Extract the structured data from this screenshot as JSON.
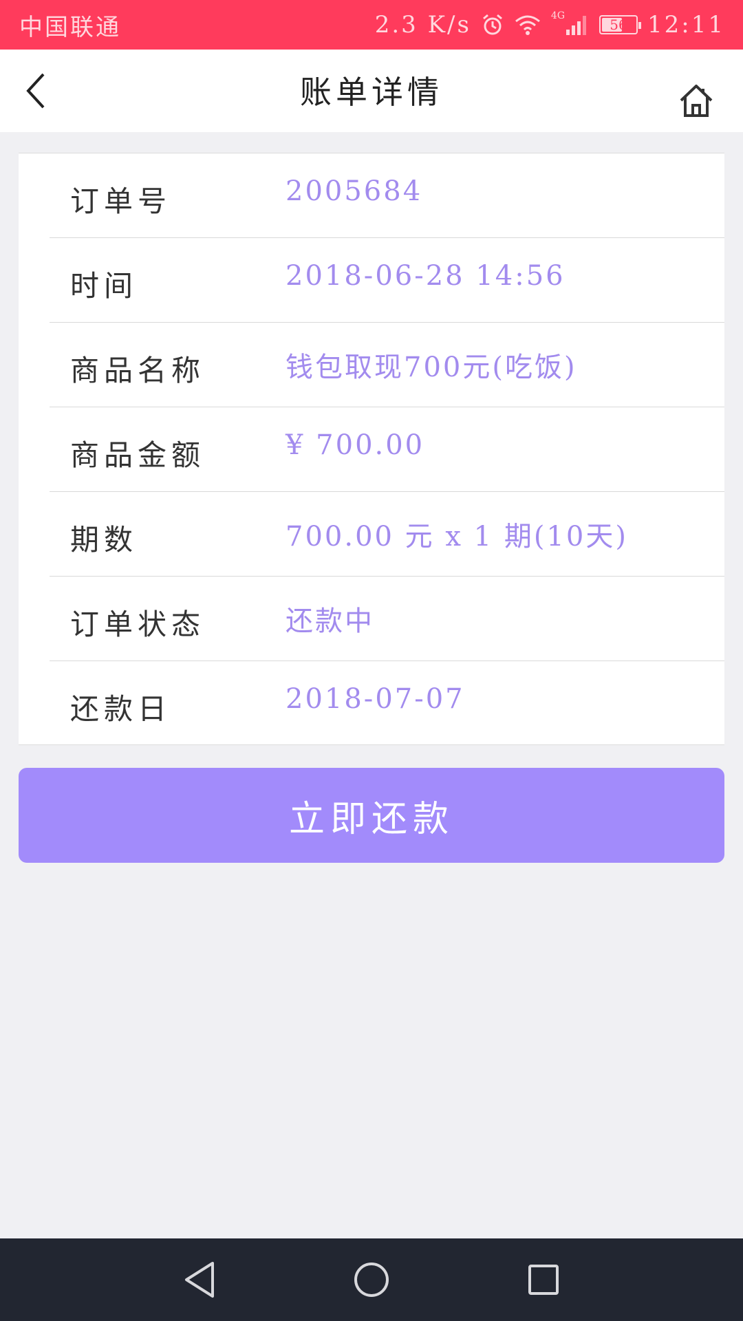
{
  "status_bar": {
    "carrier": "中国联通",
    "speed": "2.3 K/s",
    "network": "4G",
    "battery": "56",
    "time": "12:11",
    "icons": [
      "alarm-icon",
      "wifi-icon",
      "signal-icon",
      "battery-icon"
    ]
  },
  "nav": {
    "title": "账单详情",
    "back_icon": "back-arrow-icon",
    "home_icon": "home-icon"
  },
  "details": [
    {
      "label": "订单号",
      "value": "2005684"
    },
    {
      "label": "时间",
      "value": "2018-06-28 14:56"
    },
    {
      "label": "商品名称",
      "value": "钱包取现700元(吃饭)"
    },
    {
      "label": "商品金额",
      "value": "¥ 700.00"
    },
    {
      "label": "期数",
      "value": "700.00 元 x 1 期(10天)"
    },
    {
      "label": "订单状态",
      "value": "还款中"
    },
    {
      "label": "还款日",
      "value": "2018-07-07"
    }
  ],
  "actions": {
    "pay_label": "立即还款"
  },
  "system_nav": [
    "back-triangle-icon",
    "home-circle-icon",
    "recents-square-icon"
  ],
  "colors": {
    "status_bar": "#ff3b5c",
    "accent": "#a28bfb",
    "value_text": "#a28bee",
    "system_nav": "#222631",
    "background": "#f0f0f3"
  }
}
